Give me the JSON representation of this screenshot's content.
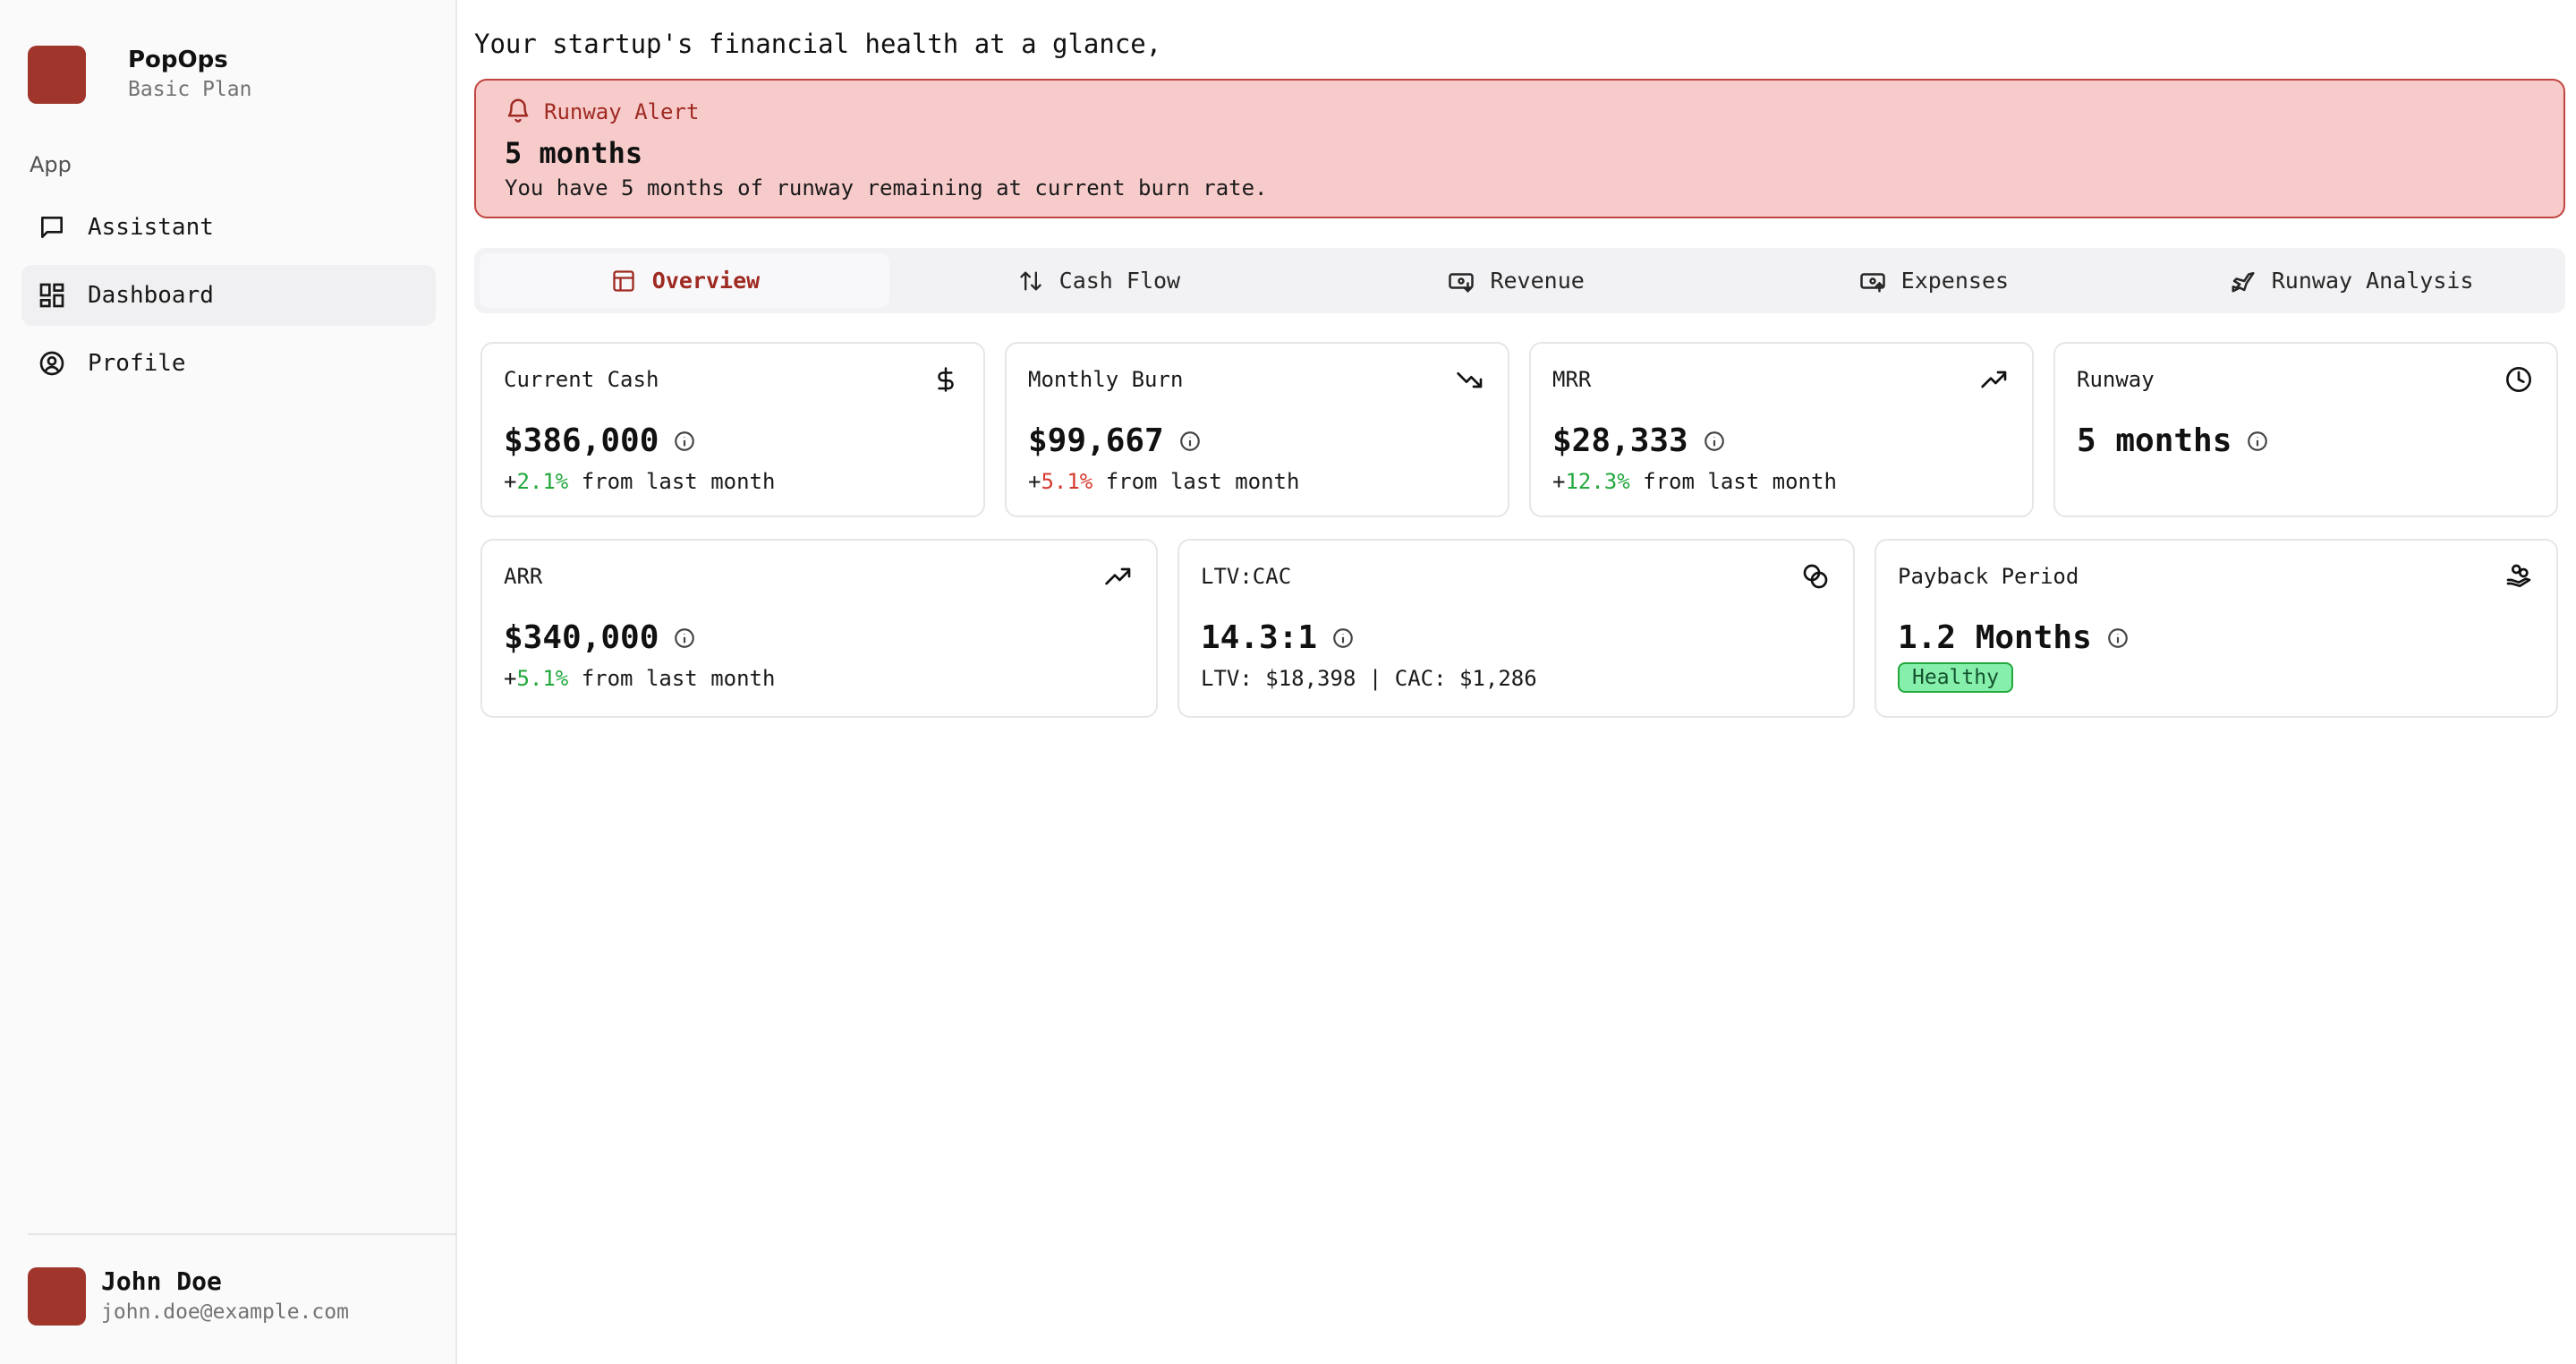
{
  "sidebar": {
    "brand_name": "PopOps",
    "plan": "Basic Plan",
    "section_label": "App",
    "items": [
      {
        "label": "Assistant",
        "icon": "message-square-icon"
      },
      {
        "label": "Dashboard",
        "icon": "layout-dashboard-icon",
        "active": true
      },
      {
        "label": "Profile",
        "icon": "user-circle-icon"
      }
    ],
    "user": {
      "name": "John Doe",
      "email": "john.doe@example.com"
    }
  },
  "main": {
    "subtitle": "Your startup's financial health at a glance,",
    "alert": {
      "title": "Runway Alert",
      "headline": "5 months",
      "description": "You have 5 months of runway remaining at current burn rate."
    },
    "tabs": [
      {
        "label": "Overview",
        "icon": "layout-icon",
        "active": true
      },
      {
        "label": "Cash Flow",
        "icon": "arrow-up-down-icon"
      },
      {
        "label": "Revenue",
        "icon": "banknote-arrow-down-icon"
      },
      {
        "label": "Expenses",
        "icon": "banknote-arrow-up-icon"
      },
      {
        "label": "Runway Analysis",
        "icon": "plane-takeoff-icon"
      }
    ],
    "metrics": [
      {
        "title": "Current Cash",
        "value": "$386,000",
        "sign": "+",
        "change": "2.1%",
        "change_tone": "positive",
        "suffix": " from last month",
        "icon": "dollar-sign-icon"
      },
      {
        "title": "Monthly Burn",
        "value": "$99,667",
        "sign": "+",
        "change": "5.1%",
        "change_tone": "negative",
        "suffix": " from last month",
        "icon": "trending-down-icon"
      },
      {
        "title": "MRR",
        "value": "$28,333",
        "sign": "+",
        "change": "12.3%",
        "change_tone": "positive",
        "suffix": " from last month",
        "icon": "trending-up-icon"
      },
      {
        "title": "Runway",
        "value": "5 months",
        "icon": "clock-icon"
      },
      {
        "title": "ARR",
        "value": "$340,000",
        "sign": "+",
        "change": "5.1%",
        "change_tone": "positive",
        "suffix": " from last month",
        "icon": "trending-up-icon"
      },
      {
        "title": "LTV:CAC",
        "value": "14.3:1",
        "sub": "LTV: $18,398 | CAC: $1,286",
        "icon": "coins-icon"
      },
      {
        "title": "Payback Period",
        "value": "1.2 Months",
        "badge": "Healthy",
        "icon": "hand-coins-icon"
      }
    ]
  },
  "colors": {
    "brand": "#9f352b",
    "alert_bg": "#f8cbcb",
    "positive": "#22a83c",
    "negative": "#d63a2f",
    "healthy_bg": "#86efac"
  }
}
